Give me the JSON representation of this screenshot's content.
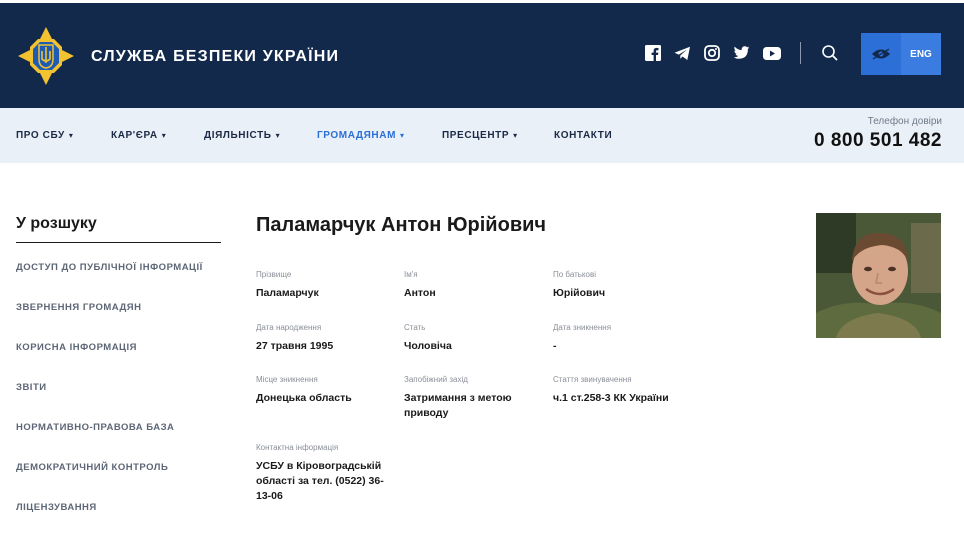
{
  "header": {
    "title": "СЛУЖБА БЕЗПЕКИ УКРАЇНИ",
    "social": [
      "facebook-icon",
      "telegram-icon",
      "instagram-icon",
      "twitter-icon",
      "youtube-icon"
    ],
    "lang_label": "ENG"
  },
  "nav": {
    "items": [
      {
        "label": "ПРО СБУ",
        "has_caret": true
      },
      {
        "label": "КАР'ЄРА",
        "has_caret": true
      },
      {
        "label": "ДІЯЛЬНІСТЬ",
        "has_caret": true
      },
      {
        "label": "ГРОМАДЯНАМ",
        "has_caret": true,
        "active": true
      },
      {
        "label": "ПРЕСЦЕНТР",
        "has_caret": true
      },
      {
        "label": "КОНТАКТИ",
        "has_caret": false
      }
    ],
    "caret": "▾",
    "hotline_label": "Телефон довіри",
    "hotline_number": "0 800 501 482"
  },
  "sidebar": {
    "title": "У розшуку",
    "items": [
      "ДОСТУП ДО ПУБЛІЧНОЇ ІНФОРМАЦІЇ",
      "ЗВЕРНЕННЯ ГРОМАДЯН",
      "КОРИСНА ІНФОРМАЦІЯ",
      "ЗВІТИ",
      "НОРМАТИВНО-ПРАВОВА БАЗА",
      "ДЕМОКРАТИЧНИЙ КОНТРОЛЬ",
      "ЛІЦЕНЗУВАННЯ"
    ]
  },
  "person": {
    "name": "Паламарчук Антон Юрійович",
    "fields": [
      {
        "label": "Прізвище",
        "value": "Паламарчук"
      },
      {
        "label": "Ім'я",
        "value": "Антон"
      },
      {
        "label": "По батькові",
        "value": "Юрійович"
      },
      {
        "label": "Дата народження",
        "value": "27 травня 1995"
      },
      {
        "label": "Стать",
        "value": "Чоловіча"
      },
      {
        "label": "Дата зникнення",
        "value": "-"
      },
      {
        "label": "Місце зникнення",
        "value": "Донецька область"
      },
      {
        "label": "Запобіжний захід",
        "value": "Затримання з метою приводу"
      },
      {
        "label": "Стаття звинувачення",
        "value": "ч.1 ст.258-3 КК України"
      },
      {
        "label": "Контактна інформація",
        "value": "УСБУ в Кіровоградській області за тел. (0522) 36-13-06"
      }
    ]
  },
  "colors": {
    "header_bg": "#13294b",
    "nav_bg": "#e9f0f8",
    "accent": "#2c6fd6",
    "emblem_gold": "#f2c230",
    "emblem_blue": "#1d5bb5"
  }
}
